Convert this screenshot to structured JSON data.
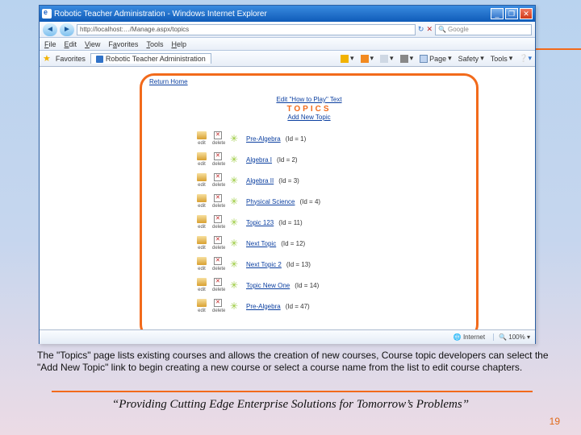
{
  "window": {
    "title": "Robotic Teacher Administration - Windows Internet Explorer",
    "address": "http://localhost:…/Manage.aspx/topics",
    "search_placeholder": "Google",
    "tab_label": "Robotic Teacher Administration"
  },
  "menu": {
    "file": "File",
    "edit": "Edit",
    "view": "View",
    "favorites": "Favorites",
    "tools": "Tools",
    "help": "Help"
  },
  "favbar": {
    "label": "Favorites"
  },
  "toolbar": {
    "page": "Page",
    "safety": "Safety",
    "tools": "Tools"
  },
  "page": {
    "back_link": "Return Home",
    "edit_howto": "Edit \"How to Play\" Text",
    "title": "TOPICS",
    "add_new": "Add New Topic",
    "col_edit": "edit",
    "col_delete": "delete"
  },
  "topics": [
    {
      "name": "Pre-Algebra",
      "id": "(Id = 1)"
    },
    {
      "name": "Algebra I",
      "id": "(Id = 2)"
    },
    {
      "name": "Algebra II",
      "id": "(Id = 3)"
    },
    {
      "name": "Physical Science",
      "id": "(Id = 4)"
    },
    {
      "name": "Topic 123",
      "id": "(Id = 11)"
    },
    {
      "name": "Next Topic",
      "id": "(Id = 12)"
    },
    {
      "name": "Next Topic 2",
      "id": "(Id = 13)"
    },
    {
      "name": "Topic New One",
      "id": "(Id = 14)"
    },
    {
      "name": "Pre-Algebra",
      "id": "(Id = 47)"
    }
  ],
  "status": {
    "internet": "Internet",
    "zoom": "100%"
  },
  "caption": "The \"Topics\" page lists existing courses and allows the creation of new courses, Course topic developers can select the \"Add New Topic\" link to begin creating a new course or select a course name from the list to edit course chapters.",
  "tagline": "“Providing Cutting Edge Enterprise Solutions for Tomorrow’s Problems”",
  "page_number": "19"
}
